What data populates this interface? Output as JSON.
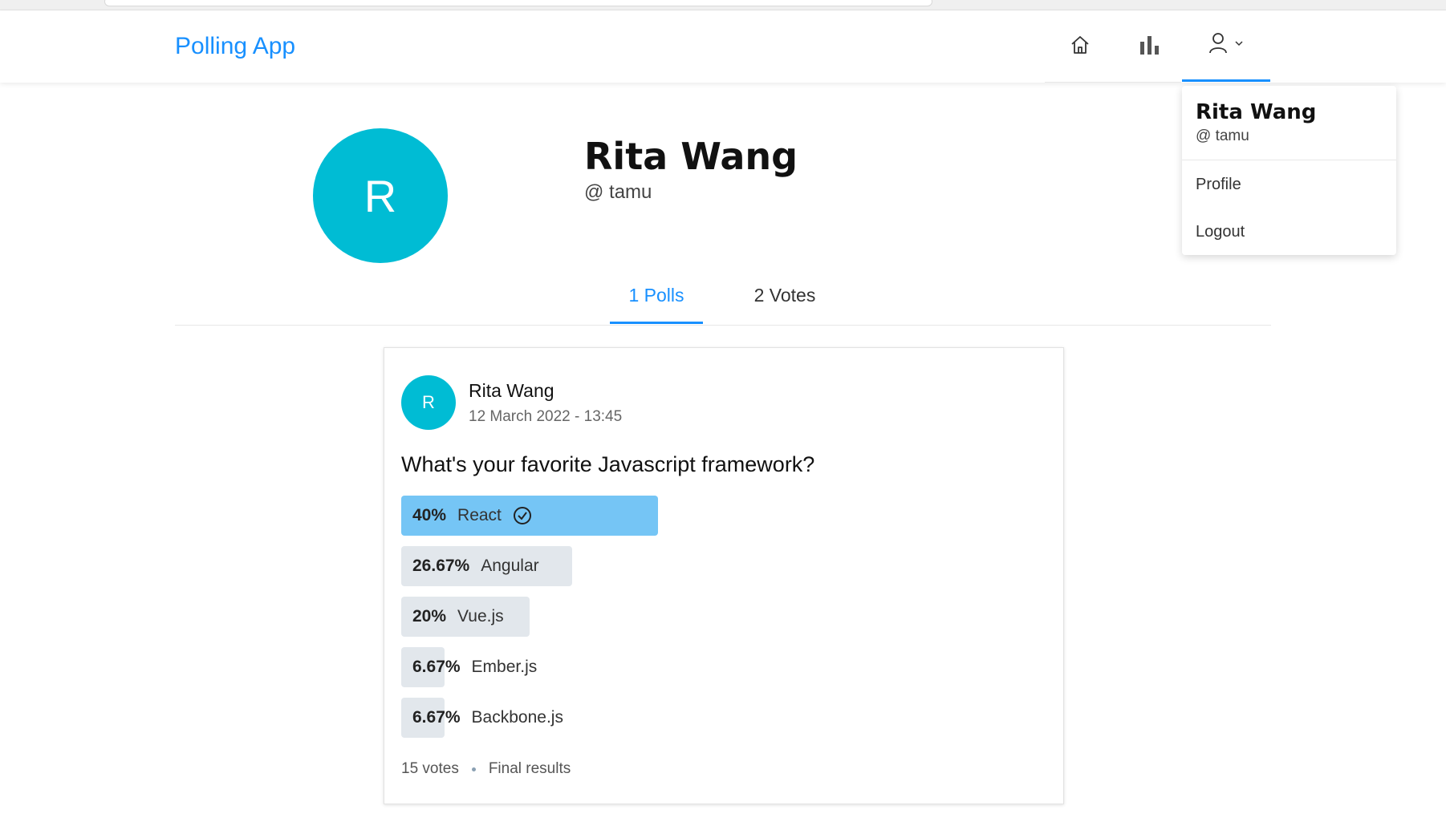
{
  "app": {
    "title": "Polling App"
  },
  "nav": {
    "home_icon": "home-icon",
    "chart_icon": "bar-chart-icon",
    "user_icon": "user-icon",
    "caret_icon": "chevron-down-icon"
  },
  "profile": {
    "avatar_letter": "R",
    "name": "Rita Wang",
    "username": "@ tamu",
    "avatar_color": "#00bcd4"
  },
  "tabs": [
    {
      "label": "1 Polls",
      "active": true
    },
    {
      "label": "2 Votes",
      "active": false
    }
  ],
  "poll": {
    "creator": {
      "avatar_letter": "R",
      "name": "Rita Wang",
      "date": "12 March 2022 - 13:45"
    },
    "question": "What's your favorite Javascript framework?",
    "choices": [
      {
        "percent_label": "40%",
        "percent": 40,
        "text": "React",
        "selected": true,
        "winner": true
      },
      {
        "percent_label": "26.67%",
        "percent": 26.67,
        "text": "Angular",
        "selected": false,
        "winner": false
      },
      {
        "percent_label": "20%",
        "percent": 20,
        "text": "Vue.js",
        "selected": false,
        "winner": false
      },
      {
        "percent_label": "6.67%",
        "percent": 6.67,
        "text": "Ember.js",
        "selected": false,
        "winner": false
      },
      {
        "percent_label": "6.67%",
        "percent": 6.67,
        "text": "Backbone.js",
        "selected": false,
        "winner": false
      }
    ],
    "total_votes": "15 votes",
    "status": "Final results"
  },
  "dropdown": {
    "name": "Rita Wang",
    "username": "@ tamu",
    "items": [
      "Profile",
      "Logout"
    ]
  },
  "colors": {
    "accent": "#1890ff",
    "winner_bar": "#75c5f5",
    "bar": "#e2e7ec"
  }
}
